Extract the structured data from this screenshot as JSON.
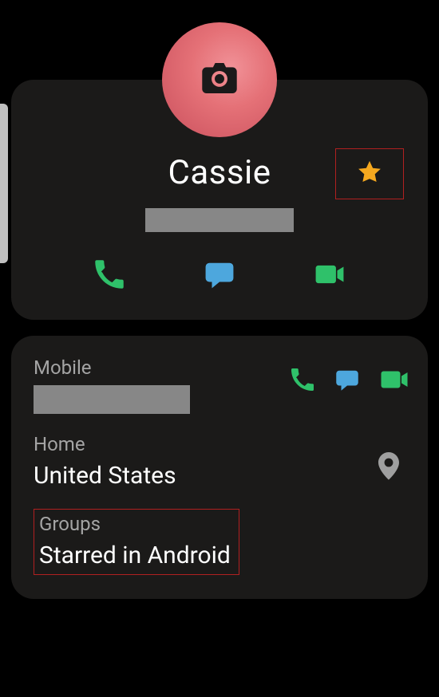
{
  "contact": {
    "name": "Cassie",
    "favorite": true
  },
  "fields": {
    "mobile_label": "Mobile",
    "home_label": "Home",
    "home_value": "United States",
    "groups_label": "Groups",
    "groups_value": "Starred in Android"
  },
  "colors": {
    "card": "#1b1a19",
    "green": "#2fc16a",
    "blue": "#4da7dd",
    "star": "#f5a81f",
    "pin": "#9f9f9f"
  }
}
